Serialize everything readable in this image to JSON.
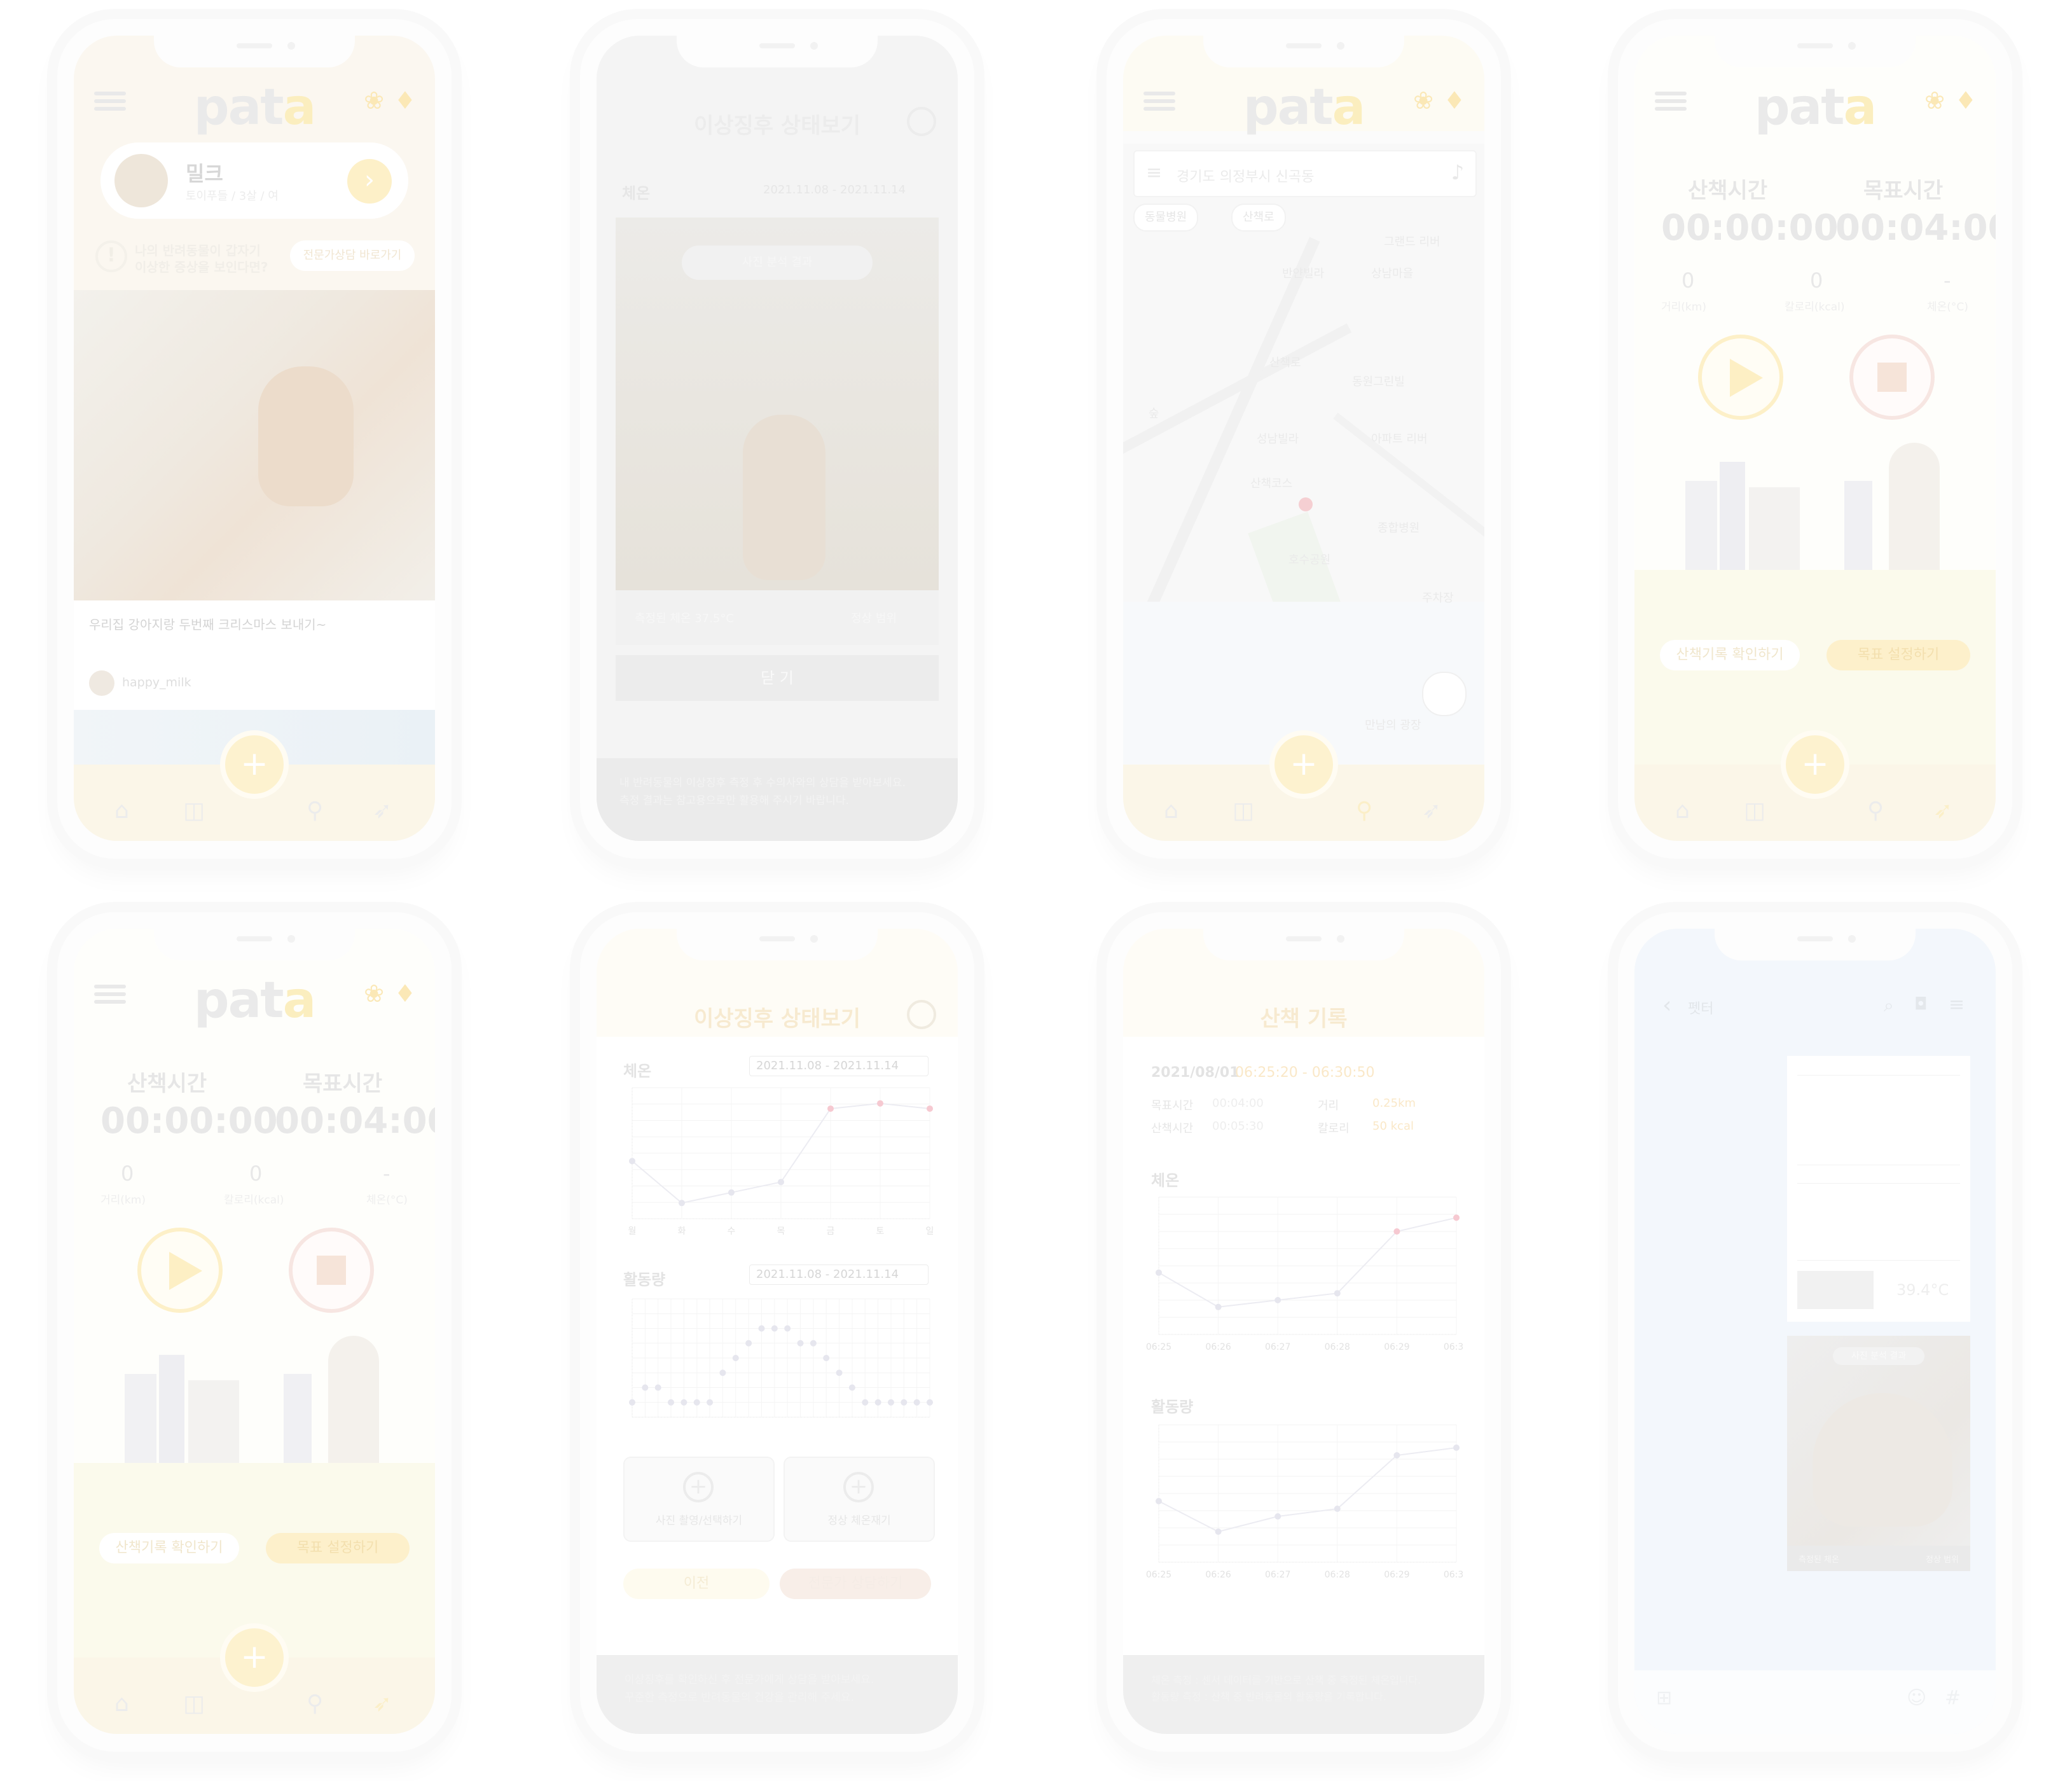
{
  "app": {
    "logo_main": "pat",
    "logo_accent": "a"
  },
  "screen_home": {
    "profile_name": "밀크",
    "profile_sub": "토이푸들 / 3살 / 여",
    "alert_line1": "나의 반려동물이 갑자기",
    "alert_line2": "이상한 증상을 보인다면?",
    "alert_button": "전문가상담 바로가기",
    "post_title": "우리집 강아지랑 두번째 크리스마스 보내기~",
    "post_user": "happy_milk"
  },
  "screen_symptom_photo": {
    "title": "이상징후 상태보기",
    "section": "체온",
    "date_range": "2021.11.08 - 2021.11.14",
    "photo_chip": "사진 분석 결과",
    "row_left": "측정된 체온 37.5°C",
    "row_right": "정상 범위",
    "close_button": "닫 기",
    "footer_line1": "내 반려동물의 이상징후 측정 후 수의사와의 상담을 받아보세요.",
    "footer_line2": "측정 결과는 참고용으로만 활용해 주시기 바랍니다."
  },
  "screen_map": {
    "search_placeholder": "경기도 의정부시 신곡동",
    "chips": [
      "동물병원",
      "산책로"
    ],
    "map_labels": [
      "반얀빌라",
      "그랜드 리버",
      "상남마을",
      "동원그린빌",
      "아파트 리버",
      "산책로",
      "성남빌라",
      "숲",
      "호수공원",
      "종합병원",
      "주차장",
      "산책코스",
      "만남의 광장"
    ]
  },
  "walk": {
    "time_label": "산책시간",
    "goal_label": "목표시간",
    "time_value": "00:00:00",
    "goal_value": "00:04:00",
    "dist_value": "0",
    "dist_label": "거리(km)",
    "cal_value": "0",
    "cal_label": "칼로리(kcal)",
    "temp_value": "-",
    "temp_label": "체온(°C)",
    "btn_records": "산책기록 확인하기",
    "btn_goal": "목표 설정하기"
  },
  "screen_symptom_charts": {
    "title": "이상징후 상태보기",
    "temp_section": "체온",
    "activity_section": "활동량",
    "date_range": "2021.11.08 - 2021.11.14",
    "weekdays": [
      "월",
      "화",
      "수",
      "목",
      "금",
      "토",
      "일"
    ],
    "photo_btn": "사진 촬영/선택하기",
    "temp_btn": "정상 체온재기",
    "btn_left": "이전",
    "btn_right": "전문가 상담하기",
    "footer_line1": "이상징후를 확인하신 후 전문가에게 상담을 받아보세요.",
    "footer_line2": "꾸준한 측정으로 반려동물의 건강을 관리해 주세요."
  },
  "screen_walk_record": {
    "title": "산책 기록",
    "date": "2021/08/01",
    "time_range": "06:25:20 - 06:30:50",
    "goal_time_label": "목표시간",
    "goal_time_value": "00:04:00",
    "dist_label": "거리",
    "dist_value": "0.25km",
    "walk_time_label": "산책시간",
    "walk_time_value": "00:05:30",
    "cal_label": "칼로리",
    "cal_value": "50 kcal",
    "temp_section": "체온",
    "activity_section": "활동량",
    "x_ticks": [
      "06:25",
      "06:26",
      "06:27",
      "06:28",
      "06:29",
      "06:30"
    ],
    "footer_line1": "체온 측정 : 센서 데이터를 기반으로 산책 중 측정된 체온입니다.",
    "footer_line2": "활동량 측정 : 산책 중 반려동물의 활동량을 기록합니다."
  },
  "screen_feed": {
    "back_label": "펫터",
    "temp_value": "39.4°C",
    "chip": "사진 분석 결과",
    "row_left": "측정된 체온",
    "row_right": "정상 범위"
  },
  "chart_data": [
    {
      "type": "line",
      "title": "체온",
      "categories": [
        "월",
        "화",
        "수",
        "목",
        "금",
        "토",
        "일"
      ],
      "series": [
        {
          "values": [
            37.6,
            36.8,
            37.0,
            37.2,
            38.6,
            38.7,
            38.6
          ]
        }
      ],
      "ylim": [
        36.5,
        39.0
      ]
    },
    {
      "type": "scatter",
      "title": "활동량",
      "series": [
        {
          "values": [
            1,
            2,
            2,
            1,
            1,
            1,
            1,
            3,
            4,
            5,
            6,
            6,
            6,
            5,
            5,
            4,
            3,
            2,
            1,
            1,
            1,
            1,
            1,
            1
          ]
        }
      ],
      "ylim": [
        0,
        8
      ]
    },
    {
      "type": "line",
      "title": "체온",
      "categories": [
        "06:25",
        "06:26",
        "06:27",
        "06:28",
        "06:29",
        "06:30"
      ],
      "series": [
        {
          "values": [
            37.4,
            36.9,
            37.0,
            37.1,
            38.0,
            38.2
          ]
        }
      ],
      "ylim": [
        36.5,
        38.5
      ]
    },
    {
      "type": "line",
      "title": "활동량",
      "categories": [
        "06:25",
        "06:26",
        "06:27",
        "06:28",
        "06:29",
        "06:30"
      ],
      "series": [
        {
          "values": [
            4,
            2,
            3,
            3.5,
            7,
            7.5
          ]
        }
      ],
      "ylim": [
        0,
        9
      ]
    }
  ],
  "colors": {
    "accent": "#fbe8b6",
    "nav_bg": "#fbf6e8",
    "marker": "#f4c7cf",
    "feed_bg": "#f3f7fc"
  }
}
